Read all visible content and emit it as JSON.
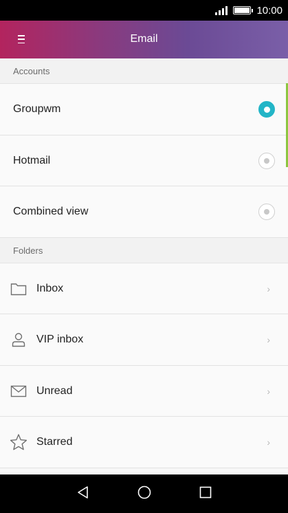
{
  "status_bar": {
    "time": "10:00"
  },
  "app_bar": {
    "title": "Email",
    "menu_icon": "menu-icon"
  },
  "accounts": {
    "header": "Accounts",
    "items": [
      {
        "label": "Groupwm",
        "selected": true
      },
      {
        "label": "Hotmail",
        "selected": false
      },
      {
        "label": "Combined view",
        "selected": false
      }
    ]
  },
  "folders": {
    "header": "Folders",
    "items": [
      {
        "label": "Inbox",
        "icon": "folder-icon"
      },
      {
        "label": "VIP inbox",
        "icon": "person-icon"
      },
      {
        "label": "Unread",
        "icon": "envelope-icon"
      },
      {
        "label": "Starred",
        "icon": "star-icon"
      }
    ]
  },
  "colors": {
    "accent": "#23b5c7",
    "scroll_indicator": "#8cc63f"
  },
  "nav_bar": {
    "icons": [
      "back-icon",
      "home-icon",
      "recents-icon"
    ]
  }
}
